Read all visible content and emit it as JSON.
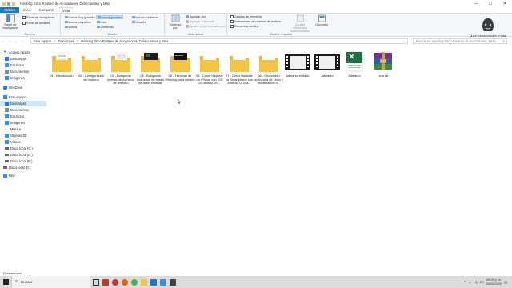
{
  "window": {
    "title": "Hacking Ético Rastreo de Acosadores, Delincuentes y Más",
    "controls": [
      "—",
      "☐",
      "✕"
    ]
  },
  "ribbon_tabs": [
    "Archivo",
    "Inicio",
    "Compartir",
    "Vista"
  ],
  "ribbon": {
    "panel": {
      "navigation_pane": "Panel de navegación",
      "preview_pane": "Panel de vista previa",
      "details_pane": "Panel de detalles",
      "label": "Paneles"
    },
    "layout": {
      "options": [
        "Iconos muy grandes",
        "Iconos grandes",
        "Iconos medianos",
        "Iconos pequeños",
        "Lista",
        "Detalles",
        "Iconos",
        "Contenido"
      ],
      "selected": "Iconos grandes",
      "label": "Diseño"
    },
    "current_view": {
      "sort_by": "Ordenar por",
      "group_by": "Agrupar por",
      "add_columns": "Agregar columnas",
      "fit_columns": "Ajustar todas las columnas",
      "label": "Vista actual"
    },
    "show_hide": {
      "checkboxes": "Casillas de elemento",
      "extensions": "Extensiones de nombre de archivo",
      "hidden": "Elementos ocultos",
      "hide_selected": "Ocultar elementos seleccionados",
      "options": "Opciones",
      "label": "Mostrar u ocultar"
    }
  },
  "logo_text": "HACKINGYMAS.COM",
  "address": {
    "crumbs": [
      "Este equipo",
      "Descargas",
      "Hacking Ético Rastreo de Acosadores, Delincuentes y Más"
    ],
    "separator": ">",
    "search_placeholder": "Buscar en Hacking Ético Rastreo de Acosadores, Delin..."
  },
  "nav_pane": [
    {
      "label": "Acceso rápido",
      "icon": "star-icon",
      "color": "#1e90ff"
    },
    {
      "label": "Descargas",
      "icon": "download-icon",
      "color": "#2e75d6"
    },
    {
      "label": "Escritorio",
      "icon": "desktop-icon",
      "color": "#3a8ee6"
    },
    {
      "label": "Documentos",
      "icon": "documents-icon",
      "color": "#7f8c99"
    },
    {
      "label": "Imágenes",
      "icon": "images-icon",
      "color": "#3a8ee6"
    },
    {
      "label": "OneDrive",
      "icon": "cloud-icon",
      "color": "#2e75d6"
    },
    {
      "label": "Este equipo",
      "icon": "computer-icon",
      "color": "#3a8ee6"
    },
    {
      "label": "Descargas",
      "icon": "download-icon",
      "color": "#2e75d6",
      "selected": true
    },
    {
      "label": "Documentos",
      "icon": "documents-icon",
      "color": "#7f8c99"
    },
    {
      "label": "Escritorio",
      "icon": "desktop-icon",
      "color": "#3a8ee6"
    },
    {
      "label": "Imágenes",
      "icon": "images-icon",
      "color": "#3a8ee6"
    },
    {
      "label": "Música",
      "icon": "music-icon",
      "color": "#3a8ee6"
    },
    {
      "label": "Objetos 3D",
      "icon": "cube-icon",
      "color": "#3a8ee6"
    },
    {
      "label": "Vídeos",
      "icon": "video-icon",
      "color": "#3a8ee6"
    },
    {
      "label": "Disco local (C:)",
      "icon": "drive-icon",
      "color": "#666666"
    },
    {
      "label": "Disco local (D:)",
      "icon": "drive-icon",
      "color": "#666666"
    },
    {
      "label": "Disco local (E:)",
      "icon": "drive-icon",
      "color": "#666666"
    },
    {
      "label": "Disco local (E:)",
      "icon": "drive-icon",
      "color": "#666666"
    },
    {
      "label": "Red",
      "icon": "network-icon",
      "color": "#3a8ee6"
    }
  ],
  "items": [
    {
      "label": "01 - Introducción",
      "kind": "folder-doc"
    },
    {
      "label": "02 - Configuracion del entorno",
      "kind": "folder-plain"
    },
    {
      "label": "03 - Búsqueda inversa de numeros de telefono",
      "kind": "folder-doc"
    },
    {
      "label": "04 - Busqueda avanzada en bases de datos filtradas",
      "kind": "folder-dark"
    },
    {
      "label": "05 - Técnicas de Phishing para rastreo",
      "kind": "folder-dark"
    },
    {
      "label": "06 - Como Hackear un IPhone con IOS 10 usando un ...",
      "kind": "folder-plain"
    },
    {
      "label": "07 - Como Hackear un Smartphone con Android 10 usa...",
      "kind": "folder-plain"
    },
    {
      "label": "08 - Ofuscación avanzada de Links y modificación d...",
      "kind": "folder-plain"
    },
    {
      "label": "Adelanto editado",
      "kind": "video"
    },
    {
      "label": "Adelanto",
      "kind": "video"
    },
    {
      "label": "Adelanto",
      "kind": "excel"
    },
    {
      "label": "hola.rar",
      "kind": "rar"
    }
  ],
  "status": {
    "count": "12 elementos"
  },
  "taskbar": {
    "search": "Buscar",
    "time": "09:09 p. m.",
    "date": "04/05/2020",
    "lang": "ES"
  },
  "colors": {
    "accent": "#1979ca",
    "folder": "#f3c543",
    "selection": "#cce8ff"
  }
}
